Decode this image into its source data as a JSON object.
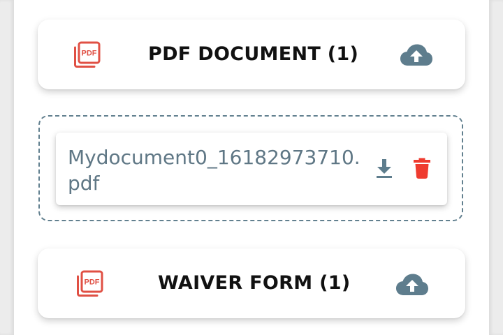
{
  "sections": [
    {
      "title": "PDF DOCUMENT (1)",
      "file_icon": "pdf-file-icon",
      "action_icon": "cloud-upload-icon"
    },
    {
      "title": "WAIVER FORM (1)",
      "file_icon": "pdf-file-icon",
      "action_icon": "cloud-upload-icon"
    }
  ],
  "uploaded_files": [
    {
      "name": "Mydocument0_16182973710.pdf",
      "actions": [
        "download-icon",
        "trash-icon"
      ]
    }
  ],
  "icon_text": {
    "pdf_label": "PDF"
  },
  "colors": {
    "pdf_icon": "#e05044",
    "upload_icon": "#5e7d8d",
    "file_name_text": "#5f7785",
    "delete_icon": "#ef3b2f",
    "dropzone_border": "#62808f"
  }
}
